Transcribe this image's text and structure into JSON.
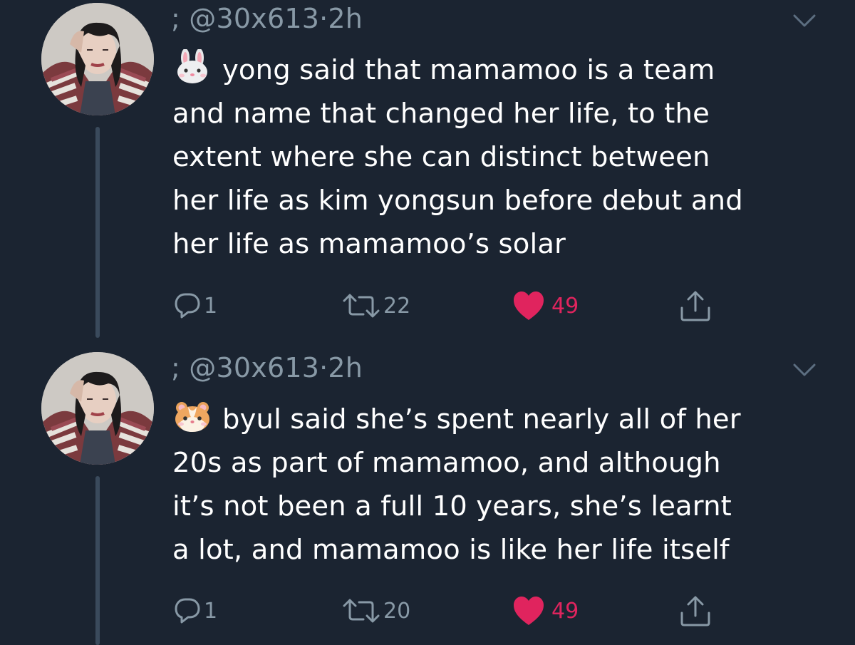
{
  "tweets": [
    {
      "prefix": ";",
      "handle": "@30x613",
      "separator": "·",
      "time": "2h",
      "emoji": "rabbit-face-emoji",
      "text_lines": [
        "yong said that mamamoo is a team",
        "and name that changed her life, to the",
        "extent where she can distinct between",
        "her life as kim yongsun before debut and",
        "her life as mamamoo’s solar"
      ],
      "replies": "1",
      "retweets": "22",
      "likes": "49"
    },
    {
      "prefix": ";",
      "handle": "@30x613",
      "separator": "·",
      "time": "2h",
      "emoji": "hamster-face-emoji",
      "text_lines": [
        "byul said she’s spent nearly all of her",
        "20s as part of mamamoo, and although",
        "it’s not been a full 10 years, she’s learnt",
        "a lot, and mamamoo is like her life itself"
      ],
      "replies": "1",
      "retweets": "20",
      "likes": "49"
    }
  ],
  "colors": {
    "background": "#1b2431",
    "secondary_text": "#8899a6",
    "like": "#e0245e",
    "thread_line": "#3a4a5c"
  }
}
